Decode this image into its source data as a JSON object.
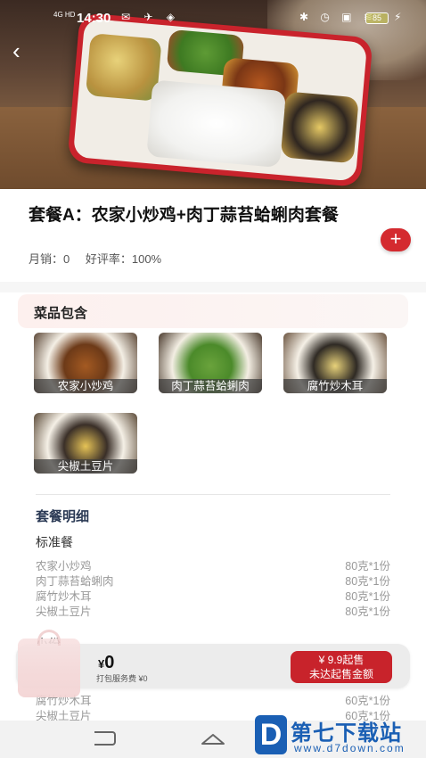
{
  "status_bar": {
    "network": "4G HD",
    "time": "14:30",
    "left_icons": "✉ ✈ ◈",
    "right_icons": "✱ ◷ ▣ ≋",
    "battery": "85"
  },
  "header": {
    "back_icon": "‹"
  },
  "product": {
    "title": "套餐A：农家小炒鸡+肉丁蒜苔蛤蜊肉套餐",
    "monthly_sales": "月销：0",
    "rating": "好评率：100%",
    "add_icon": "+"
  },
  "dishes_section": {
    "label": "菜品包含",
    "items": [
      {
        "name": "农家小炒鸡"
      },
      {
        "name": "肉丁蒜苔蛤蜊肉"
      },
      {
        "name": "腐竹炒木耳"
      },
      {
        "name": "尖椒土豆片"
      }
    ]
  },
  "detail": {
    "title": "套餐明细",
    "groups": [
      {
        "name": "标准餐",
        "rows": [
          {
            "name": "农家小炒鸡",
            "qty": "80克*1份"
          },
          {
            "name": "肉丁蒜苔蛤蜊肉",
            "qty": "80克*1份"
          },
          {
            "name": "腐竹炒木耳",
            "qty": "80克*1份"
          },
          {
            "name": "尖椒土豆片",
            "qty": "80克*1份"
          }
        ]
      },
      {
        "name": "小份",
        "rows": [
          {
            "name": "腐竹炒木耳",
            "qty": "60克*1份"
          },
          {
            "name": "尖椒土豆片",
            "qty": "60克*1份"
          }
        ]
      }
    ]
  },
  "cart": {
    "currency": "¥",
    "total": "0",
    "fee": "打包服务费 ¥0",
    "min_order": "¥ 9.9起售",
    "min_order_note": "未达起售金额"
  },
  "watermark": {
    "logo": "D",
    "title": "第七下载站",
    "url": "www.d7down.com"
  },
  "colors": {
    "accent": "#d42a2f",
    "tray": "#c9232c",
    "watermark": "#1a5fb4"
  }
}
